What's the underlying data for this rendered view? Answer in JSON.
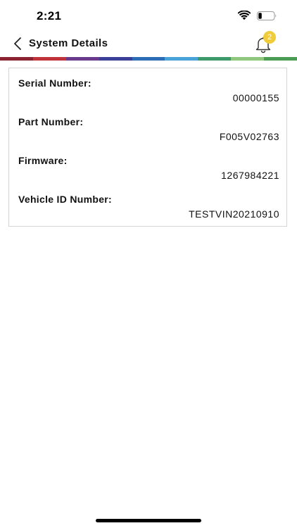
{
  "status_bar": {
    "time": "2:21"
  },
  "header": {
    "title": "System Details",
    "notification_count": "2",
    "badge_color": "#f0cc3a"
  },
  "stripe_colors": [
    "#8b2330",
    "#c0333a",
    "#6a3a8c",
    "#3c3f97",
    "#2c6db5",
    "#4aa3d8",
    "#3e9a6b",
    "#8fc77d",
    "#4b9c55"
  ],
  "details": [
    {
      "label": "Serial Number:",
      "value": "00000155"
    },
    {
      "label": "Part Number:",
      "value": "F005V02763"
    },
    {
      "label": "Firmware:",
      "value": "1267984221"
    },
    {
      "label": "Vehicle ID Number:",
      "value": "TESTVIN20210910"
    }
  ]
}
